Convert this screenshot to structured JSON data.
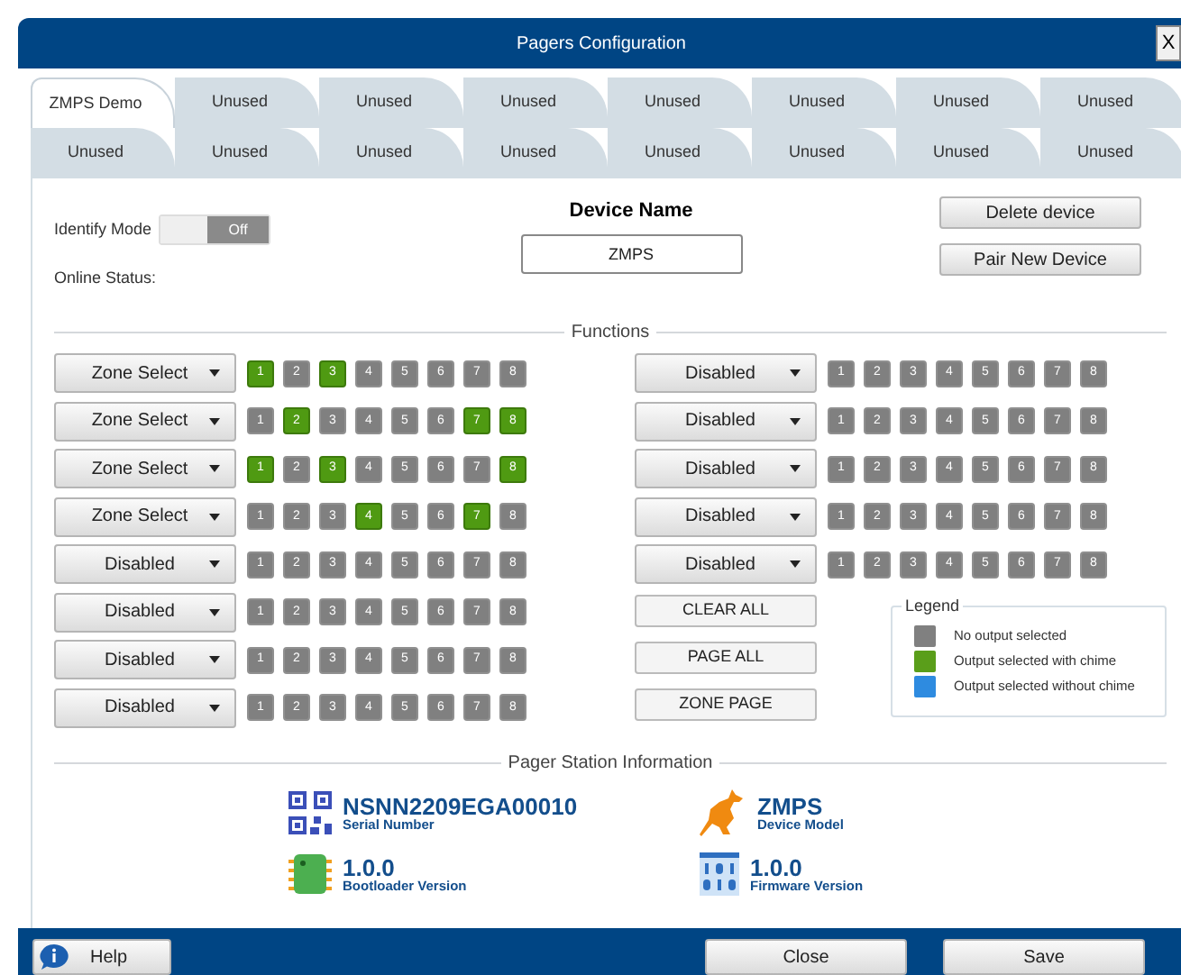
{
  "window": {
    "title": "Pagers Configuration",
    "close_label": "X"
  },
  "tabs": [
    [
      {
        "label": "ZMPS Demo",
        "selected": true
      },
      {
        "label": "Unused",
        "selected": false
      },
      {
        "label": "Unused",
        "selected": false
      },
      {
        "label": "Unused",
        "selected": false
      },
      {
        "label": "Unused",
        "selected": false
      },
      {
        "label": "Unused",
        "selected": false
      },
      {
        "label": "Unused",
        "selected": false
      },
      {
        "label": "Unused",
        "selected": false
      }
    ],
    [
      {
        "label": "Unused",
        "selected": false
      },
      {
        "label": "Unused",
        "selected": false
      },
      {
        "label": "Unused",
        "selected": false
      },
      {
        "label": "Unused",
        "selected": false
      },
      {
        "label": "Unused",
        "selected": false
      },
      {
        "label": "Unused",
        "selected": false
      },
      {
        "label": "Unused",
        "selected": false
      },
      {
        "label": "Unused",
        "selected": false
      }
    ]
  ],
  "identify_mode": {
    "label": "Identify Mode",
    "on": false,
    "state_label": "Off"
  },
  "online_status": {
    "label": "Online Status:"
  },
  "device_name": {
    "title": "Device Name",
    "value": "ZMPS"
  },
  "device_buttons": [
    "Delete device",
    "Pair New Device"
  ],
  "functions": {
    "title": "Functions",
    "left_rows": [
      {
        "mode": "Zone Select",
        "outputs": [
          {
            "label": "1",
            "selected": true
          },
          {
            "label": "2",
            "selected": false
          },
          {
            "label": "3",
            "selected": true
          },
          {
            "label": "4",
            "selected": false
          },
          {
            "label": "5",
            "selected": false
          },
          {
            "label": "6",
            "selected": false
          },
          {
            "label": "7",
            "selected": false
          },
          {
            "label": "8",
            "selected": false
          }
        ]
      },
      {
        "mode": "Zone Select",
        "outputs": [
          {
            "label": "1",
            "selected": false
          },
          {
            "label": "2",
            "selected": true
          },
          {
            "label": "3",
            "selected": false
          },
          {
            "label": "4",
            "selected": false
          },
          {
            "label": "5",
            "selected": false
          },
          {
            "label": "6",
            "selected": false
          },
          {
            "label": "7",
            "selected": true
          },
          {
            "label": "8",
            "selected": true
          }
        ]
      },
      {
        "mode": "Zone Select",
        "outputs": [
          {
            "label": "1",
            "selected": true
          },
          {
            "label": "2",
            "selected": false
          },
          {
            "label": "3",
            "selected": true
          },
          {
            "label": "4",
            "selected": false
          },
          {
            "label": "5",
            "selected": false
          },
          {
            "label": "6",
            "selected": false
          },
          {
            "label": "7",
            "selected": false
          },
          {
            "label": "8",
            "selected": true
          }
        ]
      },
      {
        "mode": "Zone Select",
        "outputs": [
          {
            "label": "1",
            "selected": false
          },
          {
            "label": "2",
            "selected": false
          },
          {
            "label": "3",
            "selected": false
          },
          {
            "label": "4",
            "selected": true
          },
          {
            "label": "5",
            "selected": false
          },
          {
            "label": "6",
            "selected": false
          },
          {
            "label": "7",
            "selected": true
          },
          {
            "label": "8",
            "selected": false
          }
        ]
      },
      {
        "mode": "Disabled",
        "outputs": [
          {
            "label": "1",
            "selected": false
          },
          {
            "label": "2",
            "selected": false
          },
          {
            "label": "3",
            "selected": false
          },
          {
            "label": "4",
            "selected": false
          },
          {
            "label": "5",
            "selected": false
          },
          {
            "label": "6",
            "selected": false
          },
          {
            "label": "7",
            "selected": false
          },
          {
            "label": "8",
            "selected": false
          }
        ]
      },
      {
        "mode": "Disabled",
        "outputs": [
          {
            "label": "1",
            "selected": false
          },
          {
            "label": "2",
            "selected": false
          },
          {
            "label": "3",
            "selected": false
          },
          {
            "label": "4",
            "selected": false
          },
          {
            "label": "5",
            "selected": false
          },
          {
            "label": "6",
            "selected": false
          },
          {
            "label": "7",
            "selected": false
          },
          {
            "label": "8",
            "selected": false
          }
        ]
      },
      {
        "mode": "Disabled",
        "outputs": [
          {
            "label": "1",
            "selected": false
          },
          {
            "label": "2",
            "selected": false
          },
          {
            "label": "3",
            "selected": false
          },
          {
            "label": "4",
            "selected": false
          },
          {
            "label": "5",
            "selected": false
          },
          {
            "label": "6",
            "selected": false
          },
          {
            "label": "7",
            "selected": false
          },
          {
            "label": "8",
            "selected": false
          }
        ]
      },
      {
        "mode": "Disabled",
        "outputs": [
          {
            "label": "1",
            "selected": false
          },
          {
            "label": "2",
            "selected": false
          },
          {
            "label": "3",
            "selected": false
          },
          {
            "label": "4",
            "selected": false
          },
          {
            "label": "5",
            "selected": false
          },
          {
            "label": "6",
            "selected": false
          },
          {
            "label": "7",
            "selected": false
          },
          {
            "label": "8",
            "selected": false
          }
        ]
      }
    ],
    "right_rows": [
      {
        "mode": "Disabled",
        "outputs": [
          {
            "label": "1",
            "selected": false
          },
          {
            "label": "2",
            "selected": false
          },
          {
            "label": "3",
            "selected": false
          },
          {
            "label": "4",
            "selected": false
          },
          {
            "label": "5",
            "selected": false
          },
          {
            "label": "6",
            "selected": false
          },
          {
            "label": "7",
            "selected": false
          },
          {
            "label": "8",
            "selected": false
          }
        ]
      },
      {
        "mode": "Disabled",
        "outputs": [
          {
            "label": "1",
            "selected": false
          },
          {
            "label": "2",
            "selected": false
          },
          {
            "label": "3",
            "selected": false
          },
          {
            "label": "4",
            "selected": false
          },
          {
            "label": "5",
            "selected": false
          },
          {
            "label": "6",
            "selected": false
          },
          {
            "label": "7",
            "selected": false
          },
          {
            "label": "8",
            "selected": false
          }
        ]
      },
      {
        "mode": "Disabled",
        "outputs": [
          {
            "label": "1",
            "selected": false
          },
          {
            "label": "2",
            "selected": false
          },
          {
            "label": "3",
            "selected": false
          },
          {
            "label": "4",
            "selected": false
          },
          {
            "label": "5",
            "selected": false
          },
          {
            "label": "6",
            "selected": false
          },
          {
            "label": "7",
            "selected": false
          },
          {
            "label": "8",
            "selected": false
          }
        ]
      },
      {
        "mode": "Disabled",
        "outputs": [
          {
            "label": "1",
            "selected": false
          },
          {
            "label": "2",
            "selected": false
          },
          {
            "label": "3",
            "selected": false
          },
          {
            "label": "4",
            "selected": false
          },
          {
            "label": "5",
            "selected": false
          },
          {
            "label": "6",
            "selected": false
          },
          {
            "label": "7",
            "selected": false
          },
          {
            "label": "8",
            "selected": false
          }
        ]
      },
      {
        "mode": "Disabled",
        "outputs": [
          {
            "label": "1",
            "selected": false
          },
          {
            "label": "2",
            "selected": false
          },
          {
            "label": "3",
            "selected": false
          },
          {
            "label": "4",
            "selected": false
          },
          {
            "label": "5",
            "selected": false
          },
          {
            "label": "6",
            "selected": false
          },
          {
            "label": "7",
            "selected": false
          },
          {
            "label": "8",
            "selected": false
          }
        ]
      }
    ],
    "actions": [
      "CLEAR ALL",
      "PAGE ALL",
      "ZONE PAGE"
    ],
    "legend": {
      "title": "Legend",
      "items": [
        {
          "label": "No output selected",
          "color": "#808080"
        },
        {
          "label": "Output selected with chime",
          "color": "#5a9e1a"
        },
        {
          "label": "Output selected without chime",
          "color": "#2e8be0"
        }
      ]
    }
  },
  "station_info": {
    "title": "Pager Station Information",
    "items": [
      {
        "kind": "serial",
        "value": "NSNN2209EGA00010",
        "caption": "Serial Number"
      },
      {
        "kind": "model",
        "value": "ZMPS",
        "caption": "Device Model"
      },
      {
        "kind": "bootloader",
        "value": "1.0.0",
        "caption": "Bootloader Version"
      },
      {
        "kind": "firmware",
        "value": "1.0.0",
        "caption": "Firmware Version"
      }
    ]
  },
  "footer": {
    "help": "Help",
    "buttons": [
      "Close",
      "Save"
    ]
  }
}
